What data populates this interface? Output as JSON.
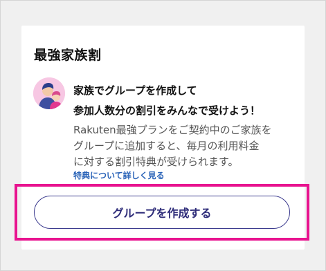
{
  "card": {
    "title": "最強家族割",
    "headline_line1": "家族でグループを作成して",
    "headline_line2": "参加人数分の割引をみんなで受けよう！",
    "description_line1": "Rakuten最強プランをご契約中のご家族を",
    "description_line2": "グループに追加すると、毎月の利用料金",
    "description_line3": "に対する割引特典が受けられます。",
    "details_link": "特典について詳しく見る",
    "cta_button": "グループを作成する"
  },
  "icons": {
    "avatar": "family-avatar-icon"
  },
  "colors": {
    "background": "#f0f0f0",
    "card": "#ffffff",
    "link": "#2a63b8",
    "button_border": "#3b3a8e",
    "button_text": "#2f2d7a",
    "highlight": "#e8138f",
    "avatar_bg": "#f7c7e3"
  }
}
